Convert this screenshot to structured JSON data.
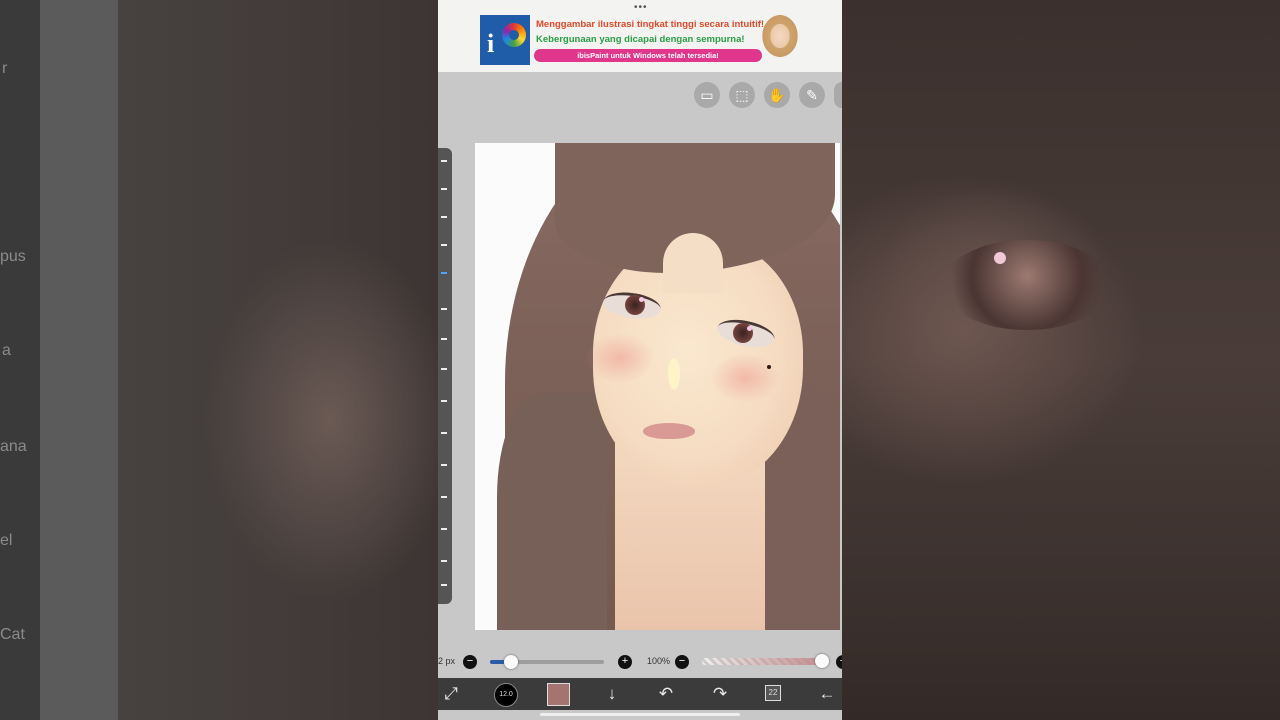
{
  "background": {
    "left_fragments": [
      "r",
      "pus",
      "a",
      "ana",
      "el",
      "Cat"
    ]
  },
  "ad": {
    "line1": "Menggambar ilustrasi tingkat tinggi secara intuitif!",
    "line2": "Kebergunaan yang dicapai dengan sempurna!",
    "pill": "ibisPaint untuk Windows telah tersedia!",
    "logo_letter": "i",
    "dots": "•••"
  },
  "top_toolbar": {
    "icons": [
      "material-icon",
      "selection-icon",
      "hand-icon",
      "ruler-icon"
    ]
  },
  "canvas": {
    "artwork": "portrait-illustration"
  },
  "sliders": {
    "brush_size_label": "2 px",
    "brush_size_fraction": 0.18,
    "opacity_label": "100%",
    "opacity_fraction": 1.0
  },
  "bottom_toolbar": {
    "brush_size_badge": "12.0",
    "current_color": "#a67470",
    "layer_number": "22",
    "icons": [
      "transform-icon",
      "brush-icon",
      "color-icon",
      "download-icon",
      "undo-icon",
      "redo-icon",
      "layer-icon",
      "back-icon"
    ]
  },
  "colors": {
    "slider_accent": "#2a5aa8",
    "bottom_bar": "#3b3b3b",
    "ad_pill": "#e0368c"
  }
}
